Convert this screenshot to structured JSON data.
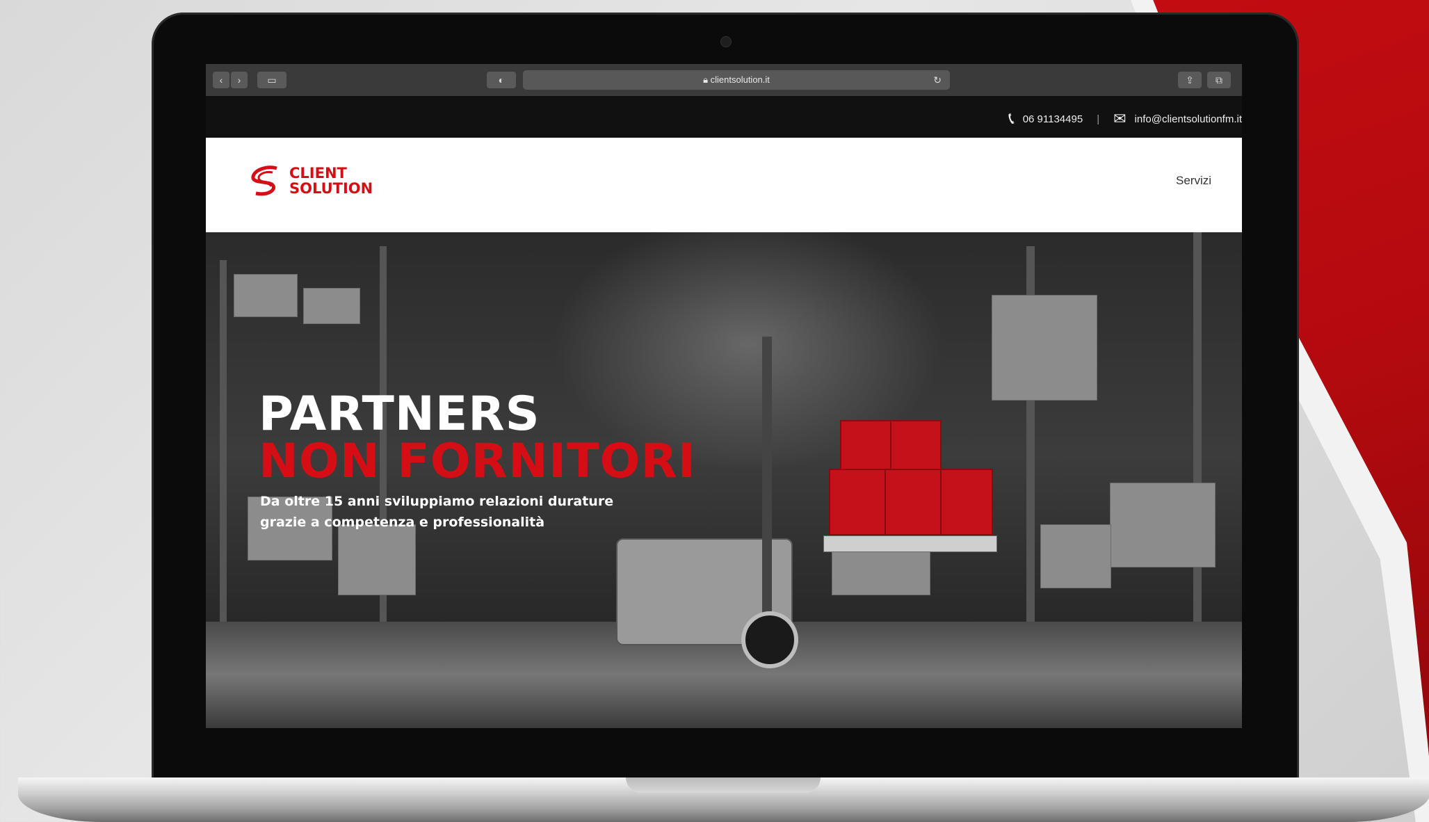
{
  "browser": {
    "url": "clientsolution.it",
    "back_icon": "chevron-left-icon",
    "forward_icon": "chevron-right-icon",
    "sidebar_icon": "sidebar-icon",
    "reader_icon": "half-circle-icon",
    "share_icon": "share-icon",
    "tabs_icon": "tabs-icon"
  },
  "contact_bar": {
    "phone": "06 91134495",
    "separator": "|",
    "email": "info@clientsolutionfm.it"
  },
  "header": {
    "logo_line1": "CLIENT",
    "logo_line2": "SOLUTION",
    "nav": [
      "Servizi"
    ]
  },
  "hero": {
    "title_line1": "PARTNERS",
    "title_line2": "NON FORNITORI",
    "subtitle_line1": "Da oltre 15 anni sviluppiamo relazioni durature",
    "subtitle_line2": "grazie a competenza e professionalità"
  },
  "colors": {
    "brand_red": "#d40e14",
    "topbar_bg": "#111111",
    "header_bg": "#ffffff"
  }
}
